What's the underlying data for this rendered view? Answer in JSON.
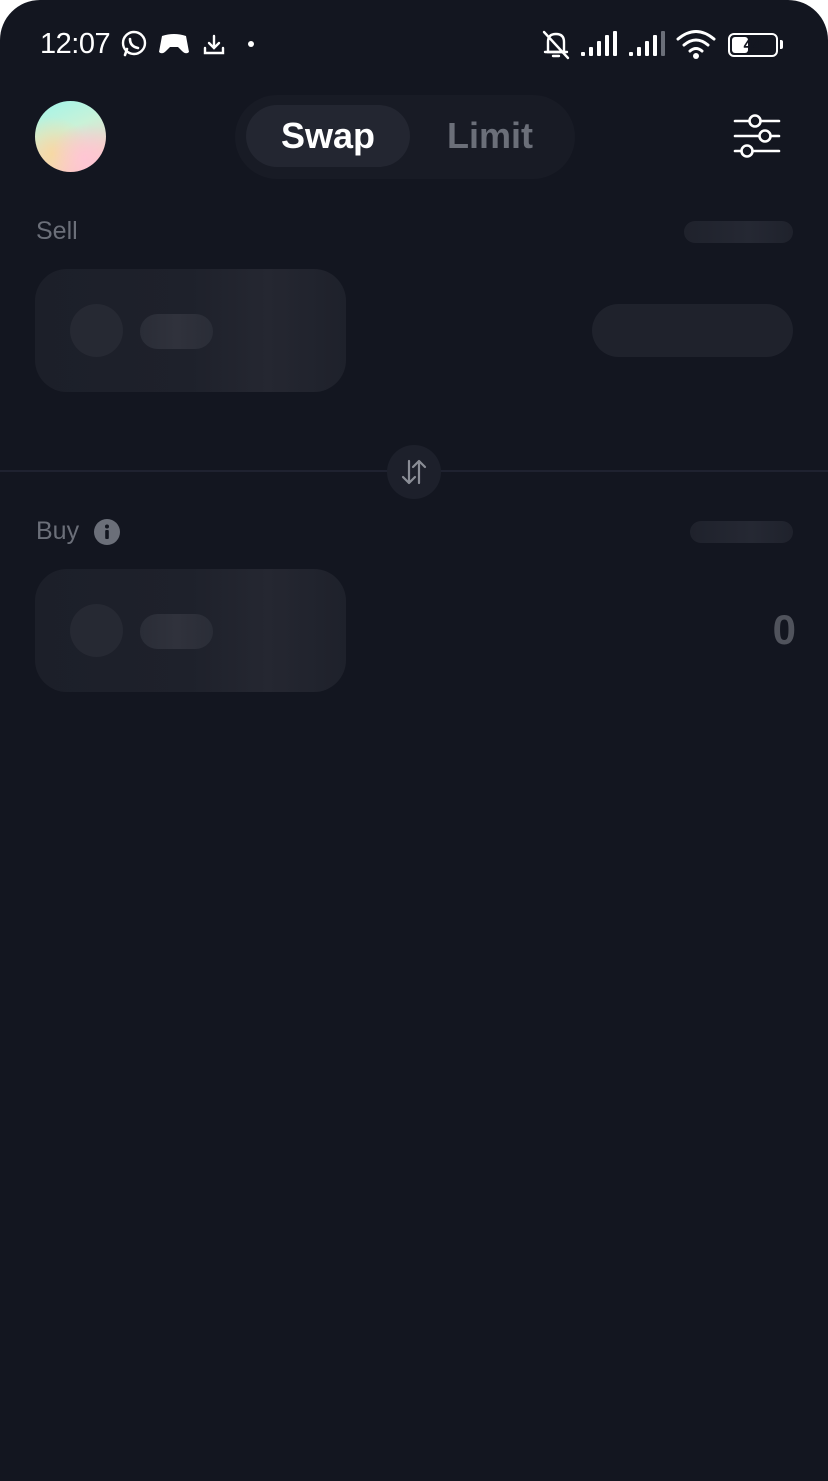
{
  "status_bar": {
    "time": "12:07",
    "battery": 44,
    "icons": [
      "whatsapp-icon",
      "game-controller-icon",
      "download-icon",
      "dot-icon",
      "bell-off-icon",
      "signal-icon",
      "signal-icon",
      "wifi-icon",
      "battery-icon"
    ]
  },
  "header": {
    "tabs": [
      {
        "label": "Swap",
        "active": true
      },
      {
        "label": "Limit",
        "active": false
      }
    ],
    "settings_icon": "sliders-icon"
  },
  "sell": {
    "label": "Sell"
  },
  "switch_icon": "swap-arrows-icon",
  "buy": {
    "label": "Buy",
    "info_icon": "info-icon",
    "amount": "0"
  },
  "colors": {
    "background": "#131620",
    "tab_active_bg": "#232631",
    "muted_text": "#6b6f79",
    "skeleton": "#1e212b"
  }
}
